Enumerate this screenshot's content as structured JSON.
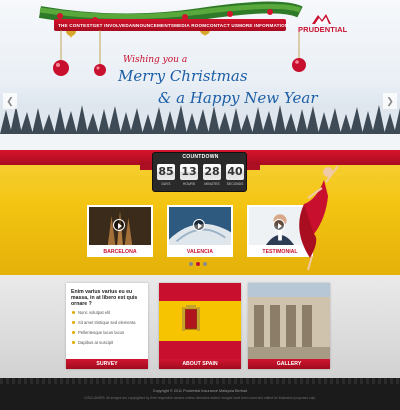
{
  "nav": {
    "items": [
      "THE CONTEST",
      "GET INVOLVED",
      "ANNOUNCEMENTS",
      "MEDIA ROOM",
      "CONTACT US",
      "MORE INFORMATION"
    ]
  },
  "brand": {
    "name": "PRUDENTIAL"
  },
  "hero": {
    "greeting": "Wishing you a",
    "line1": "Merry Christmas",
    "line2": "& a Happy New Year"
  },
  "countdown": {
    "title": "COUNTDOWN",
    "values": [
      "85",
      "13",
      "28",
      "40"
    ],
    "labels": [
      "DAYS",
      "HOURS",
      "MINUTES",
      "SECONDS"
    ]
  },
  "videos": {
    "items": [
      {
        "label": "BARCELONA"
      },
      {
        "label": "VALENCIA"
      },
      {
        "label": "TESTIMONIAL"
      }
    ],
    "pager": {
      "pages": 3,
      "active": 1
    }
  },
  "survey": {
    "question": "Enim varius varius eu eu massa, in at libero est quis ornare ?",
    "options": [
      "Nunc volutpat elit",
      "Sit amet tristique sed elementa",
      "Pellentesque lacus lacus",
      "Dapibus at suscipit"
    ],
    "button": "SURVEY"
  },
  "about": {
    "button": "ABOUT SPAIN"
  },
  "gallery": {
    "button": "GALLERY"
  },
  "footer": {
    "copyright": "Copyright © 2011 Prudential Insurance Malaysia Berhad",
    "disclaimer": "DISCLAIMER: All images are copyrighted by their respective owners unless otherwise stated. Images have been used and edited for illustration purposes only."
  },
  "colors": {
    "brand_red": "#c8102e",
    "headline_blue": "#1d5fa6",
    "countdown_yellow": "#f3c411"
  }
}
